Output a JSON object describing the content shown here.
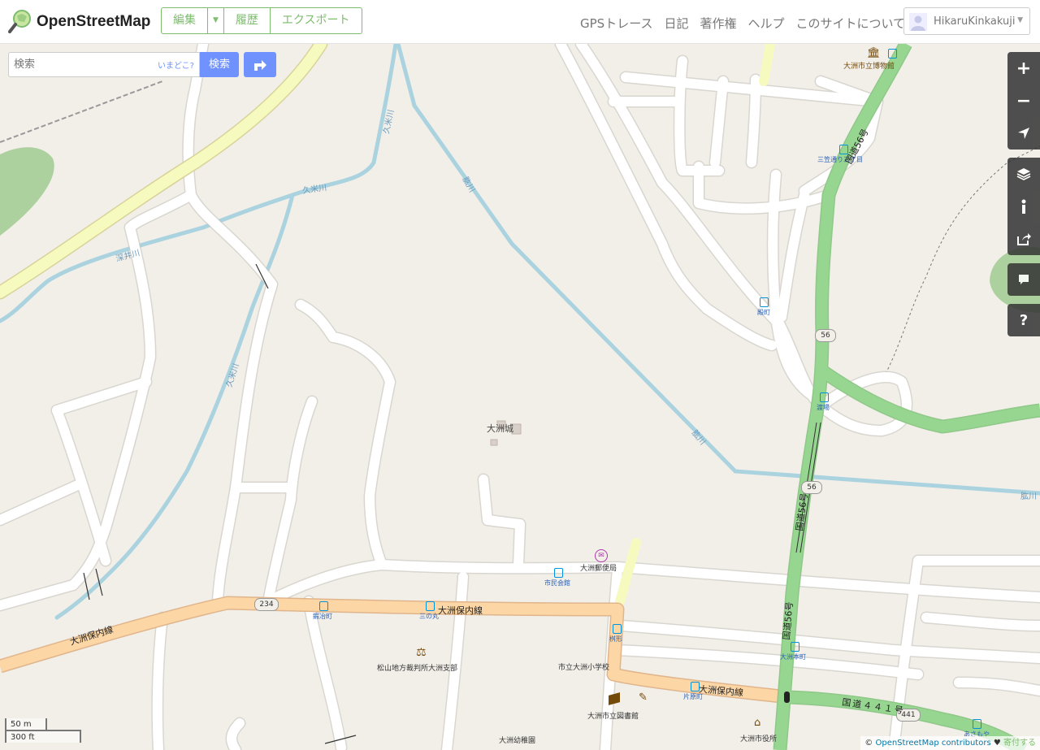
{
  "header": {
    "brand": "OpenStreetMap",
    "actions": [
      {
        "label": "編集"
      },
      {
        "label": "▼"
      },
      {
        "label": "履歴"
      },
      {
        "label": "エクスポート"
      }
    ],
    "secondary_nav": [
      "GPSトレース",
      "日記",
      "著作権",
      "ヘルプ",
      "このサイトについて"
    ],
    "user": {
      "name": "HikaruKinkakuji",
      "caret": "▼"
    }
  },
  "search": {
    "placeholder": "検索",
    "where_am_i": "いまどこ?",
    "submit_label": "検索",
    "directions_icon": "directions-icon"
  },
  "controls": {
    "zoom_in": "+",
    "zoom_out": "−",
    "icons": [
      "zoom-in-icon",
      "zoom-out-icon",
      "locate-icon",
      "layers-icon",
      "info-icon",
      "share-icon",
      "note-icon",
      "help-icon"
    ],
    "help": "?"
  },
  "map": {
    "places": {
      "castle": "大洲城",
      "museum": "大洲市立博物館",
      "post_office": "大洲郵便局",
      "civic_hall": "市民会館",
      "court": "松山地方裁判所大洲支部",
      "school": "市立大洲小学校",
      "library": "大洲市立図書館",
      "city_hall": "大洲市役所",
      "kindergarten": "大洲幼稚園"
    },
    "bus_stops": {
      "mikasa": "三笠通り三丁目",
      "tonomachi": "殿町",
      "watariba": "渡場",
      "kajiyamachi": "鍜冶町",
      "sannomaru": "三の丸",
      "masugata": "桝形",
      "katahara": "片原町",
      "ozuhonmachi": "大洲本町",
      "asamoya": "あさもや"
    },
    "roads": {
      "ozuhonai": "大洲保内線",
      "route56": "国道56号",
      "route441": "国道４４１号",
      "shield_56": "56",
      "shield_234": "234",
      "shield_441": "441"
    },
    "rivers": {
      "kume": "久米川",
      "fukai": "深井川",
      "hiji": "肱川"
    }
  },
  "footer": {
    "scale_metric": "50 m",
    "scale_imperial": "300 ft",
    "copyright": "©",
    "attribution_link": "OpenStreetMap contributors",
    "heart": "♥",
    "donate": "寄付する"
  }
}
